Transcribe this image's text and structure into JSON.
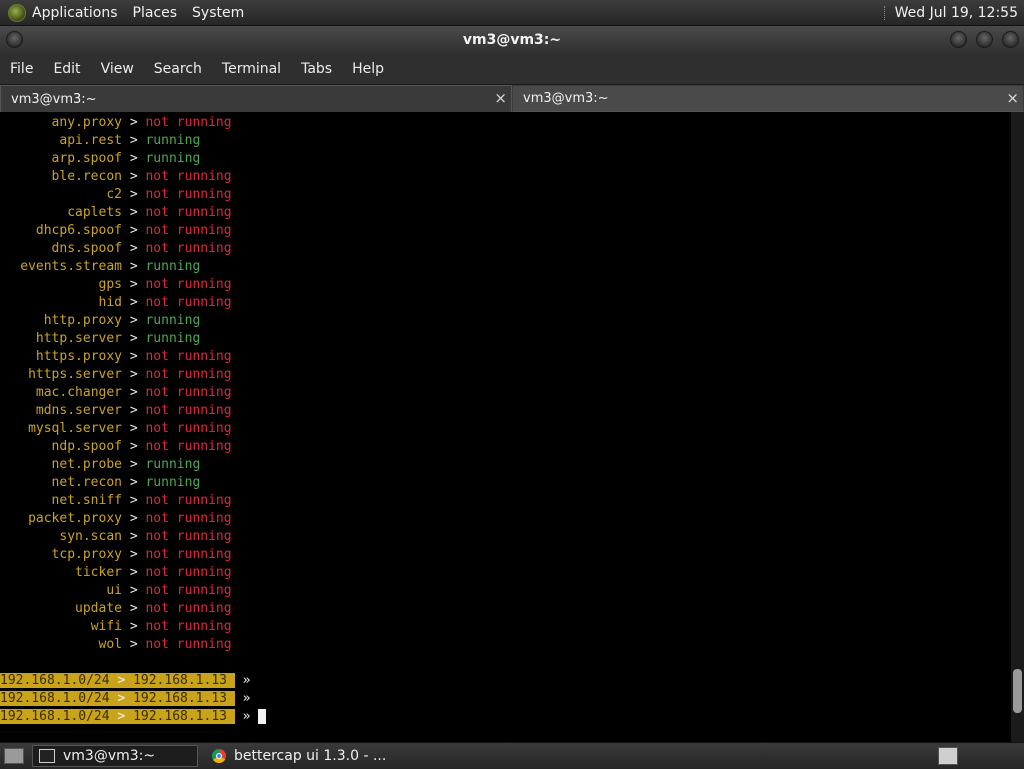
{
  "top_panel": {
    "menus": [
      "Applications",
      "Places",
      "System"
    ],
    "clock": "Wed Jul 19, 12:55"
  },
  "window": {
    "title": "vm3@vm3:~"
  },
  "menu_bar": [
    "File",
    "Edit",
    "View",
    "Search",
    "Terminal",
    "Tabs",
    "Help"
  ],
  "tabs": [
    {
      "label": "vm3@vm3:~",
      "close": "×",
      "active": true
    },
    {
      "label": "vm3@vm3:~",
      "close": "×",
      "active": false
    }
  ],
  "terminal": {
    "separator": ">",
    "modules": [
      {
        "name": "any.proxy",
        "status": "not running"
      },
      {
        "name": "api.rest",
        "status": "running"
      },
      {
        "name": "arp.spoof",
        "status": "running"
      },
      {
        "name": "ble.recon",
        "status": "not running"
      },
      {
        "name": "c2",
        "status": "not running"
      },
      {
        "name": "caplets",
        "status": "not running"
      },
      {
        "name": "dhcp6.spoof",
        "status": "not running"
      },
      {
        "name": "dns.spoof",
        "status": "not running"
      },
      {
        "name": "events.stream",
        "status": "running"
      },
      {
        "name": "gps",
        "status": "not running"
      },
      {
        "name": "hid",
        "status": "not running"
      },
      {
        "name": "http.proxy",
        "status": "running"
      },
      {
        "name": "http.server",
        "status": "running"
      },
      {
        "name": "https.proxy",
        "status": "not running"
      },
      {
        "name": "https.server",
        "status": "not running"
      },
      {
        "name": "mac.changer",
        "status": "not running"
      },
      {
        "name": "mdns.server",
        "status": "not running"
      },
      {
        "name": "mysql.server",
        "status": "not running"
      },
      {
        "name": "ndp.spoof",
        "status": "not running"
      },
      {
        "name": "net.probe",
        "status": "running"
      },
      {
        "name": "net.recon",
        "status": "running"
      },
      {
        "name": "net.sniff",
        "status": "not running"
      },
      {
        "name": "packet.proxy",
        "status": "not running"
      },
      {
        "name": "syn.scan",
        "status": "not running"
      },
      {
        "name": "tcp.proxy",
        "status": "not running"
      },
      {
        "name": "ticker",
        "status": "not running"
      },
      {
        "name": "ui",
        "status": "not running"
      },
      {
        "name": "update",
        "status": "not running"
      },
      {
        "name": "wifi",
        "status": "not running"
      },
      {
        "name": "wol",
        "status": "not running"
      }
    ],
    "prompts": [
      {
        "subnet": "192.168.1.0/24",
        "arrow": ">",
        "ip": "192.168.1.13",
        "chevron": "»"
      },
      {
        "subnet": "192.168.1.0/24",
        "arrow": ">",
        "ip": "192.168.1.13",
        "chevron": "»"
      },
      {
        "subnet": "192.168.1.0/24",
        "arrow": ">",
        "ip": "192.168.1.13",
        "chevron": "»"
      }
    ],
    "scroll_position": 0.95,
    "colors": {
      "module_name": "#c9a227",
      "running": "#4fa84f",
      "not_running": "#d9293b",
      "prompt_bg": "#c9a31a"
    }
  },
  "taskbar": {
    "tasks": [
      {
        "label": "vm3@vm3:~",
        "icon": "terminal-icon",
        "active": true
      },
      {
        "label": "bettercap ui 1.3.0 - ...",
        "icon": "chrome-icon",
        "active": false
      }
    ]
  }
}
